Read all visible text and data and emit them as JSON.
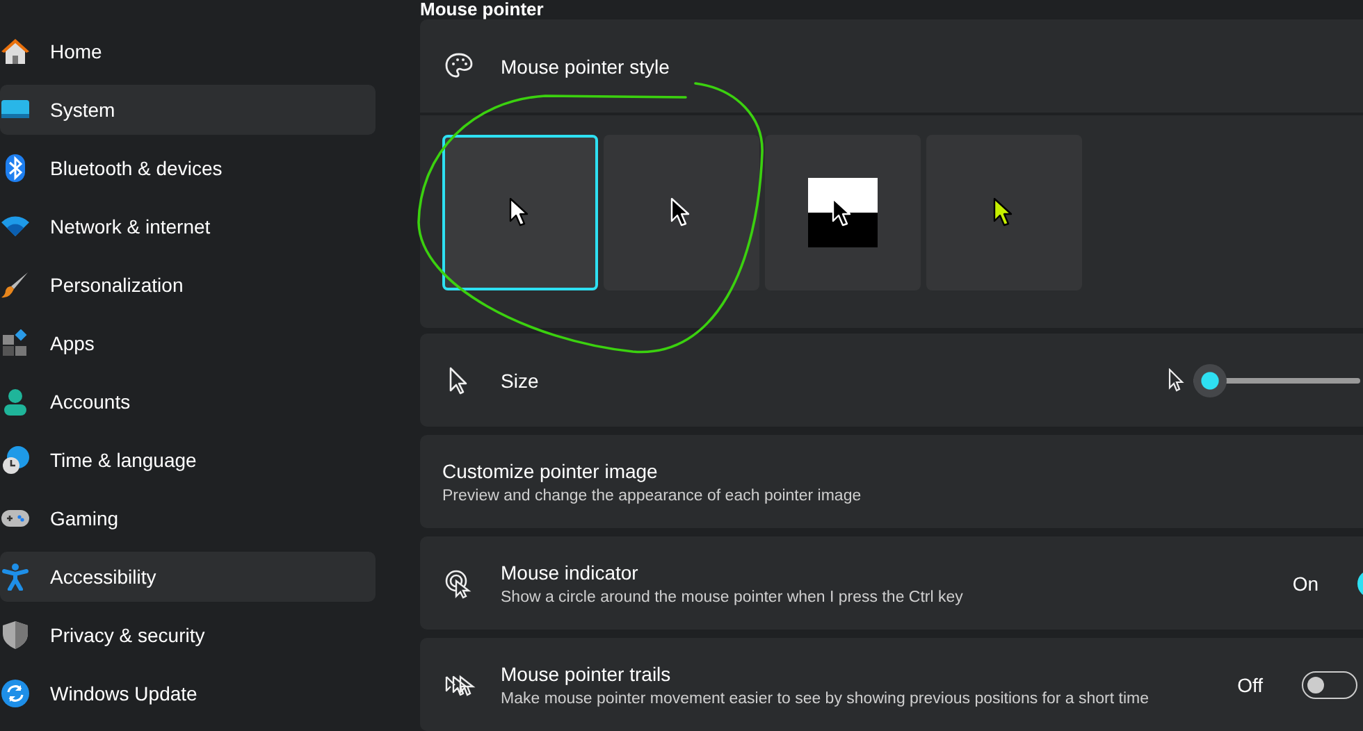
{
  "sidebar": {
    "items": [
      {
        "label": "Home",
        "selected": false
      },
      {
        "label": "System",
        "selected": true
      },
      {
        "label": "Bluetooth & devices",
        "selected": false
      },
      {
        "label": "Network & internet",
        "selected": false
      },
      {
        "label": "Personalization",
        "selected": false
      },
      {
        "label": "Apps",
        "selected": false
      },
      {
        "label": "Accounts",
        "selected": false
      },
      {
        "label": "Time & language",
        "selected": false
      },
      {
        "label": "Gaming",
        "selected": false
      },
      {
        "label": "Accessibility",
        "selected": true
      },
      {
        "label": "Privacy & security",
        "selected": false
      },
      {
        "label": "Windows Update",
        "selected": false
      }
    ]
  },
  "section_title": "Mouse pointer",
  "pointer_style": {
    "title": "Mouse pointer style",
    "tiles": [
      {
        "kind": "white",
        "selected": true
      },
      {
        "kind": "black",
        "selected": false
      },
      {
        "kind": "inverted",
        "selected": false
      },
      {
        "kind": "custom",
        "selected": false,
        "color": "#c6ef00"
      }
    ]
  },
  "size": {
    "title": "Size",
    "level": 0
  },
  "customize": {
    "title": "Customize pointer image",
    "description": "Preview and change the appearance of each pointer image"
  },
  "mouse_indicator": {
    "title": "Mouse indicator",
    "description": "Show a circle around the mouse pointer when I press the Ctrl key",
    "state_label": "On",
    "on": true
  },
  "trails": {
    "title": "Mouse pointer trails",
    "description": "Make mouse pointer movement easier to see by showing previous positions for a short time",
    "state_label": "Off",
    "on": false
  }
}
